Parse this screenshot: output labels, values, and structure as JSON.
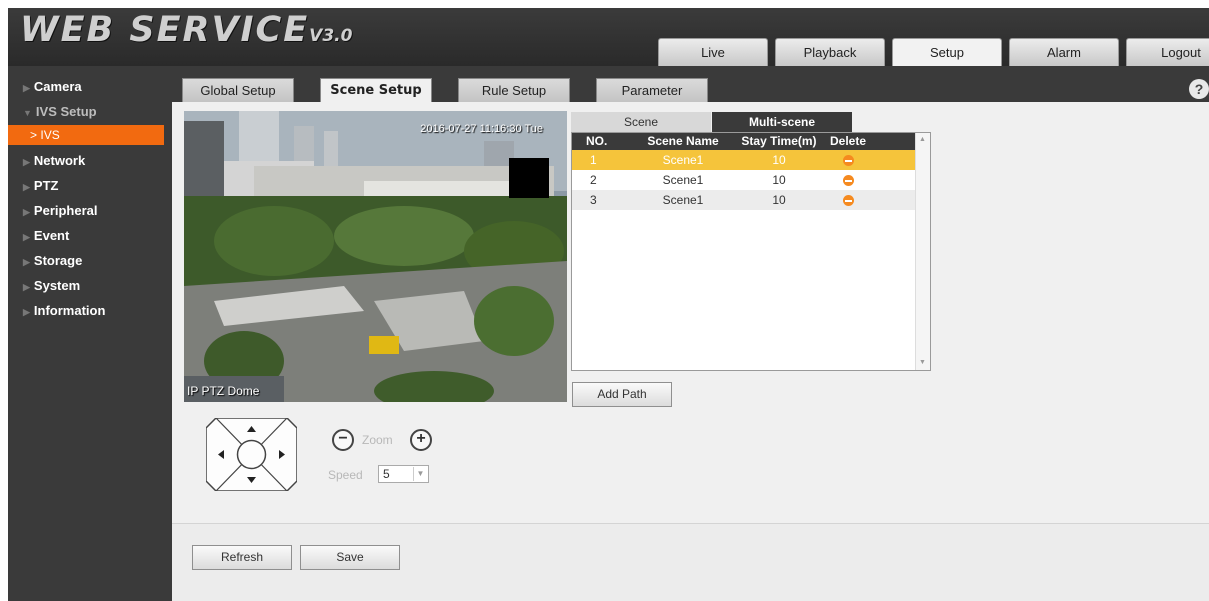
{
  "header": {
    "logo_main": "WEB SERVICE",
    "logo_version": "V3.0",
    "nav": [
      {
        "label": "Live"
      },
      {
        "label": "Playback"
      },
      {
        "label": "Setup"
      },
      {
        "label": "Alarm"
      },
      {
        "label": "Logout"
      }
    ],
    "active_nav": "Setup"
  },
  "sidebar": {
    "items": [
      {
        "label": "Camera"
      },
      {
        "label": "IVS Setup",
        "expanded": true,
        "sub": [
          {
            "label": "IVS",
            "active": true
          }
        ]
      },
      {
        "label": "Network"
      },
      {
        "label": "PTZ"
      },
      {
        "label": "Peripheral"
      },
      {
        "label": "Event"
      },
      {
        "label": "Storage"
      },
      {
        "label": "System"
      },
      {
        "label": "Information"
      }
    ]
  },
  "subtabs": [
    {
      "label": "Global Setup"
    },
    {
      "label": "Scene Setup",
      "active": true
    },
    {
      "label": "Rule Setup"
    },
    {
      "label": "Parameter"
    }
  ],
  "help_icon": "?",
  "video": {
    "timestamp": "2016-07-27 11:16:30 Tue",
    "camera_name": "IP PTZ Dome"
  },
  "scene_tabs": [
    {
      "label": "Scene"
    },
    {
      "label": "Multi-scene",
      "active": true
    }
  ],
  "table": {
    "headers": [
      "NO.",
      "Scene Name",
      "Stay Time(m)",
      "Delete"
    ],
    "rows": [
      {
        "no": "1",
        "name": "Scene1",
        "stay": "10",
        "selected": true
      },
      {
        "no": "2",
        "name": "Scene1",
        "stay": "10"
      },
      {
        "no": "3",
        "name": "Scene1",
        "stay": "10"
      }
    ]
  },
  "add_path_label": "Add Path",
  "ptz": {
    "zoom_label": "Zoom",
    "speed_label": "Speed",
    "speed_value": "5"
  },
  "buttons": {
    "refresh": "Refresh",
    "save": "Save"
  },
  "colors": {
    "accent": "#f26a10",
    "selected_row": "#f5c43b",
    "dark_bg": "#3a3a3a"
  }
}
